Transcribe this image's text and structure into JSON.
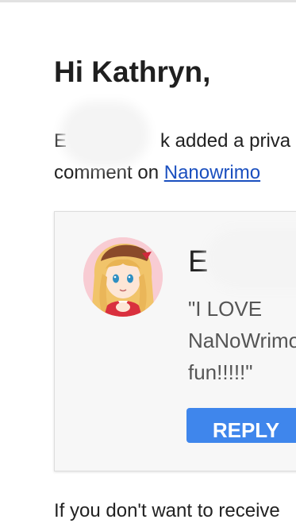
{
  "email": {
    "greeting": "Hi Kathryn,",
    "intro_line1_prefix": "E",
    "intro_line1_suffix": "k added a priva",
    "intro_line2_prefix": "comment on ",
    "intro_link": "Nanowrimo",
    "comment_card": {
      "author_initial": "E",
      "comment_lines": [
        "\"I LOVE",
        "NaNoWrimo",
        "fun!!!!!\""
      ],
      "reply_label": "REPLY"
    },
    "footer_text": "If you don't want to receive"
  },
  "colors": {
    "link": "#1a4fbf",
    "reply_button": "#3f86ec",
    "card_background": "#f7f7f7"
  },
  "icons": {
    "avatar": "anime-girl-avatar"
  }
}
